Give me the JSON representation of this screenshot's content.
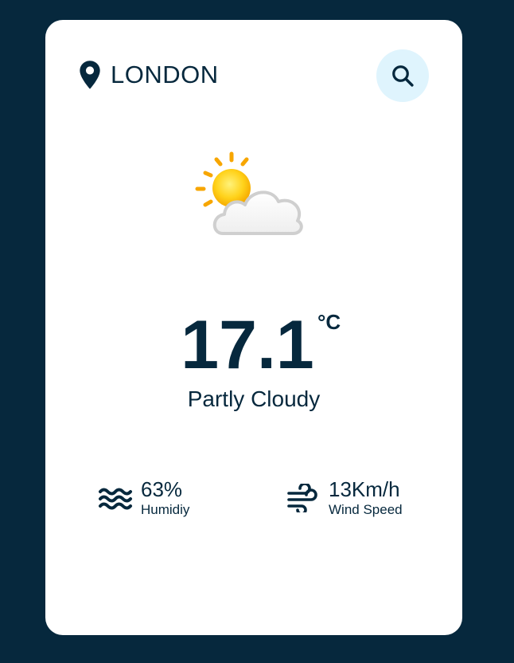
{
  "location": {
    "city": "LONDON",
    "icon": "map-pin-icon"
  },
  "search": {
    "icon": "search-icon"
  },
  "weather": {
    "icon": "partly-cloudy-icon",
    "temperature": "17.1",
    "unit": "°C",
    "condition": "Partly Cloudy"
  },
  "details": {
    "humidity": {
      "value": "63%",
      "label": "Humidiy",
      "icon": "water-waves-icon"
    },
    "wind": {
      "value": "13Km/h",
      "label": "Wind Speed",
      "icon": "wind-icon"
    }
  },
  "colors": {
    "background": "#06283d",
    "card": "#ffffff",
    "text": "#06283d",
    "search_bg": "#dff4fd"
  }
}
